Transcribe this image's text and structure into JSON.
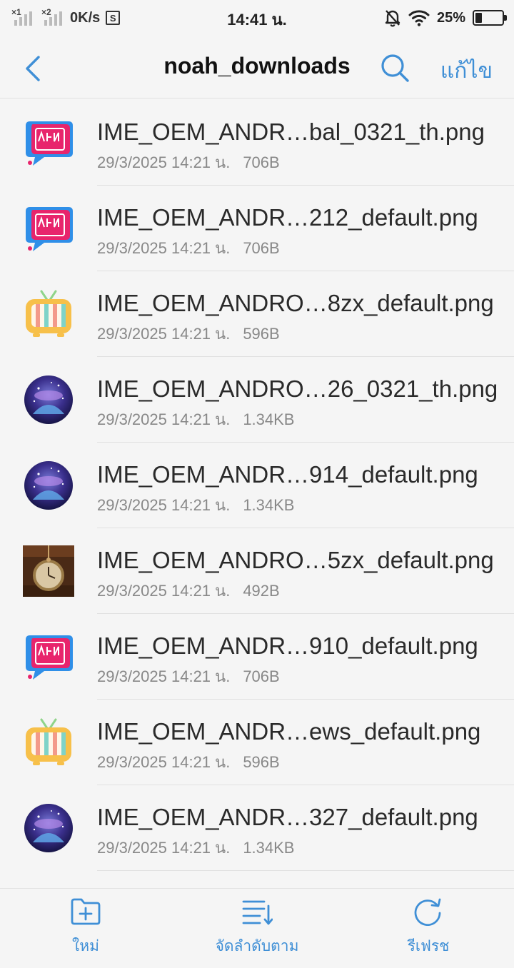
{
  "status_bar": {
    "sim1": "×1",
    "sim2": "×2",
    "net_speed": "0K/s",
    "s_icon": "S",
    "time": "14:41 น.",
    "battery_pct": "25%",
    "battery_level": 0.25,
    "icons": [
      "signal-sim1-icon",
      "signal-sim2-icon",
      "speed-saver-icon",
      "silent-bell-icon",
      "wifi-icon",
      "battery-icon"
    ]
  },
  "header": {
    "title": "noah_downloads",
    "edit_label": "แก้ไข",
    "icons": [
      "back-icon",
      "search-icon"
    ]
  },
  "files": [
    {
      "name": "IME_OEM_ANDR…bal_0321_th.png",
      "date": "29/3/2025 14:21 น.",
      "size": "706B",
      "thumb": "news-bubble"
    },
    {
      "name": "IME_OEM_ANDR…212_default.png",
      "date": "29/3/2025 14:21 น.",
      "size": "706B",
      "thumb": "news-bubble"
    },
    {
      "name": "IME_OEM_ANDRO…8zx_default.png",
      "date": "29/3/2025 14:21 น.",
      "size": "596B",
      "thumb": "tv"
    },
    {
      "name": "IME_OEM_ANDRO…26_0321_th.png",
      "date": "29/3/2025 14:21 น.",
      "size": "1.34KB",
      "thumb": "galaxy"
    },
    {
      "name": "IME_OEM_ANDR…914_default.png",
      "date": "29/3/2025 14:21 น.",
      "size": "1.34KB",
      "thumb": "galaxy"
    },
    {
      "name": "IME_OEM_ANDRO…5zx_default.png",
      "date": "29/3/2025 14:21 น.",
      "size": "492B",
      "thumb": "clock"
    },
    {
      "name": "IME_OEM_ANDR…910_default.png",
      "date": "29/3/2025 14:21 น.",
      "size": "706B",
      "thumb": "news-bubble"
    },
    {
      "name": "IME_OEM_ANDR…ews_default.png",
      "date": "29/3/2025 14:21 น.",
      "size": "596B",
      "thumb": "tv"
    },
    {
      "name": "IME_OEM_ANDR…327_default.png",
      "date": "29/3/2025 14:21 น.",
      "size": "1.34KB",
      "thumb": "galaxy"
    }
  ],
  "toolbar": {
    "new_label": "ใหม่",
    "sort_label": "จัดลำดับตาม",
    "refresh_label": "รีเฟรช",
    "icons": [
      "new-folder-icon",
      "sort-icon",
      "refresh-icon"
    ]
  },
  "colors": {
    "accent": "#3f8fd6",
    "background": "#f5f5f5",
    "divider": "#e0e0e0",
    "meta_text": "#888888"
  }
}
